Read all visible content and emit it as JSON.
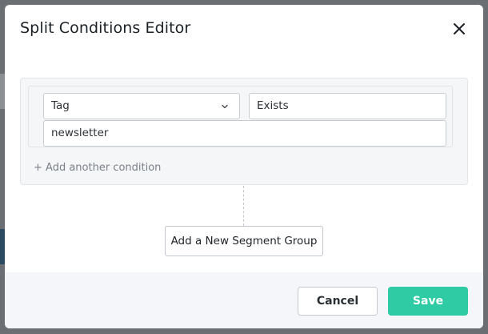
{
  "dialog": {
    "title": "Split Conditions Editor"
  },
  "condition": {
    "field_value": "Tag",
    "operator_value": "Exists",
    "value_text": "newsletter"
  },
  "actions": {
    "add_condition_label": "+ Add another condition",
    "add_segment_group_label": "Add a New Segment Group"
  },
  "footer": {
    "cancel_label": "Cancel",
    "save_label": "Save"
  },
  "colors": {
    "save_accent": "#2ecba4",
    "overlay": "#6b6f74"
  }
}
